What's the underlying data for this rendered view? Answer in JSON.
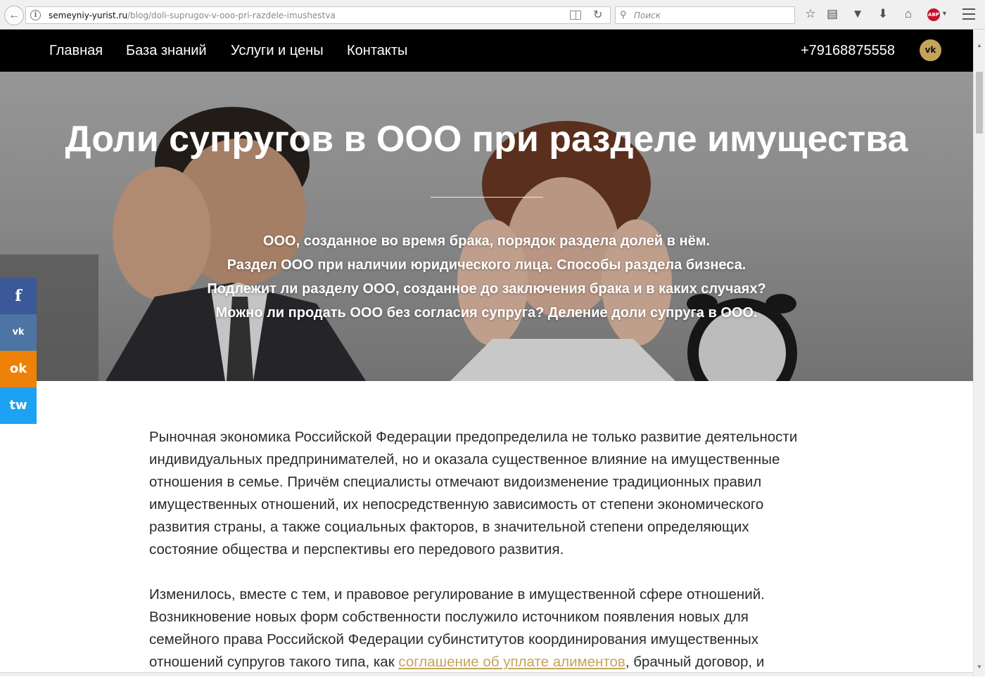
{
  "browser": {
    "url_host": "semeyniy-yurist.ru",
    "url_path": "/blog/doli-suprugov-v-ooo-pri-razdele-imushestva",
    "search_placeholder": "Поиск",
    "abp_label": "ABP"
  },
  "nav": {
    "items": [
      "Главная",
      "База знаний",
      "Услуги и цены",
      "Контакты"
    ],
    "phone": "+79168875558",
    "vk_label": "vk"
  },
  "hero": {
    "title": "Доли супругов в ООО при разделе имущества",
    "lines": [
      "ООО, созданное во время брака, порядок раздела долей в нём.",
      "Раздел ООО при наличии юридического лица. Способы раздела бизнеса.",
      "Подлежит ли разделу ООО, созданное до заключения брака и в каких случаях?",
      "Можно ли продать ООО без согласия супруга? Деление доли супруга в ООО."
    ]
  },
  "share": {
    "facebook": "f",
    "vk": "vk",
    "odnoklassniki": "ok",
    "twitter": "tw"
  },
  "article": {
    "p1": "Рыночная экономика Российской Федерации предопределила не только развитие деятельности индивидуальных предпринимателей, но и оказала существенное влияние на имущественные отношения в семье. Причём специалисты отмечают видоизменение традиционных правил имущественных отношений, их непосредственную зависимость от степени экономического развития страны, а также социальных факторов, в значительной степени определяющих состояние общества и перспективы его передового развития.",
    "p2_before": "Изменилось, вместе с тем, и правовое регулирование в имущественной сфере отношений. Возникновение новых форм собственности послужило источником появления новых для семейного права Российской Федерации субинститутов координирования имущественных отношений супругов такого типа, как ",
    "p2_link": "соглашение об уплате алиментов",
    "p2_after": ", брачный договор, и"
  },
  "colors": {
    "nav_bg": "#000000",
    "accent": "#c5a35c",
    "facebook": "#3b5998",
    "vk": "#4c75a3",
    "odnoklassniki": "#ee8208",
    "twitter": "#1da1f2"
  },
  "icons": {
    "back": "back-arrow-icon",
    "info": "info-icon",
    "reader": "reader-view-icon",
    "reload": "reload-icon",
    "search": "search-icon",
    "bookmark": "star-icon",
    "library": "library-icon",
    "pocket": "pocket-icon",
    "downloads": "download-icon",
    "home": "home-icon",
    "menu": "hamburger-menu-icon"
  }
}
